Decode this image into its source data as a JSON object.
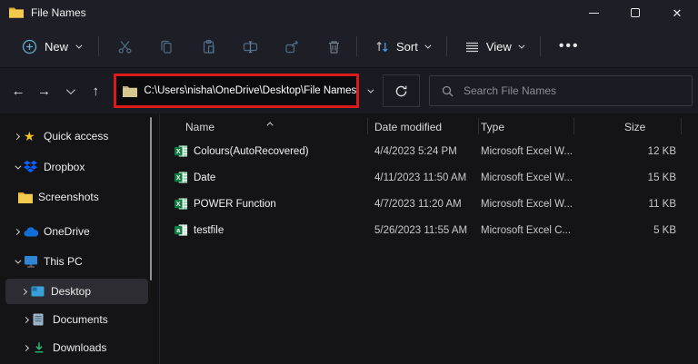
{
  "window": {
    "title": "File Names"
  },
  "toolbar": {
    "new_label": "New",
    "sort_label": "Sort",
    "view_label": "View",
    "more_label": "•••",
    "icons": [
      "new",
      "cut",
      "copy",
      "paste",
      "rename",
      "share",
      "delete",
      "sort",
      "view",
      "more"
    ]
  },
  "address_bar": {
    "path": "C:\\Users\\nisha\\OneDrive\\Desktop\\File Names",
    "search_placeholder": "Search File Names"
  },
  "sidebar": {
    "items": [
      {
        "label": "Quick access",
        "icon": "star",
        "chevron": "right"
      },
      {
        "label": "Dropbox",
        "icon": "dropbox",
        "chevron": "down"
      },
      {
        "label": "Screenshots",
        "icon": "folder",
        "chevron": "none"
      },
      {
        "label": "OneDrive",
        "icon": "cloud",
        "chevron": "right"
      },
      {
        "label": "This PC",
        "icon": "monitor",
        "chevron": "down"
      },
      {
        "label": "Desktop",
        "icon": "desktop",
        "chevron": "right",
        "selected": true
      },
      {
        "label": "Documents",
        "icon": "document",
        "chevron": "right"
      },
      {
        "label": "Downloads",
        "icon": "download",
        "chevron": "right"
      }
    ]
  },
  "file_list": {
    "columns": [
      "Name",
      "Date modified",
      "Type",
      "Size"
    ],
    "sort_column": "Name",
    "sort_direction": "ascending",
    "rows": [
      {
        "name": "Colours(AutoRecovered)",
        "date_modified": "4/4/2023 5:24 PM",
        "type": "Microsoft Excel W...",
        "size": "12 KB"
      },
      {
        "name": "Date",
        "date_modified": "4/11/2023 11:50 AM",
        "type": "Microsoft Excel W...",
        "size": "15 KB"
      },
      {
        "name": "POWER Function",
        "date_modified": "4/7/2023 11:20 AM",
        "type": "Microsoft Excel W...",
        "size": "11 KB"
      },
      {
        "name": "testfile",
        "date_modified": "5/26/2023 11:55 AM",
        "type": "Microsoft Excel C...",
        "size": "5 KB"
      }
    ]
  },
  "colors": {
    "annotation_red": "#d81a1a",
    "excel_green": "#107c41",
    "folder_yellow": "#f3c94e",
    "dropbox_blue": "#0061fe",
    "onedrive_blue": "#0f6fd7",
    "downloads_green": "#21b573",
    "titlebar_bg": "#1e1e27",
    "content_bg": "#141417"
  }
}
